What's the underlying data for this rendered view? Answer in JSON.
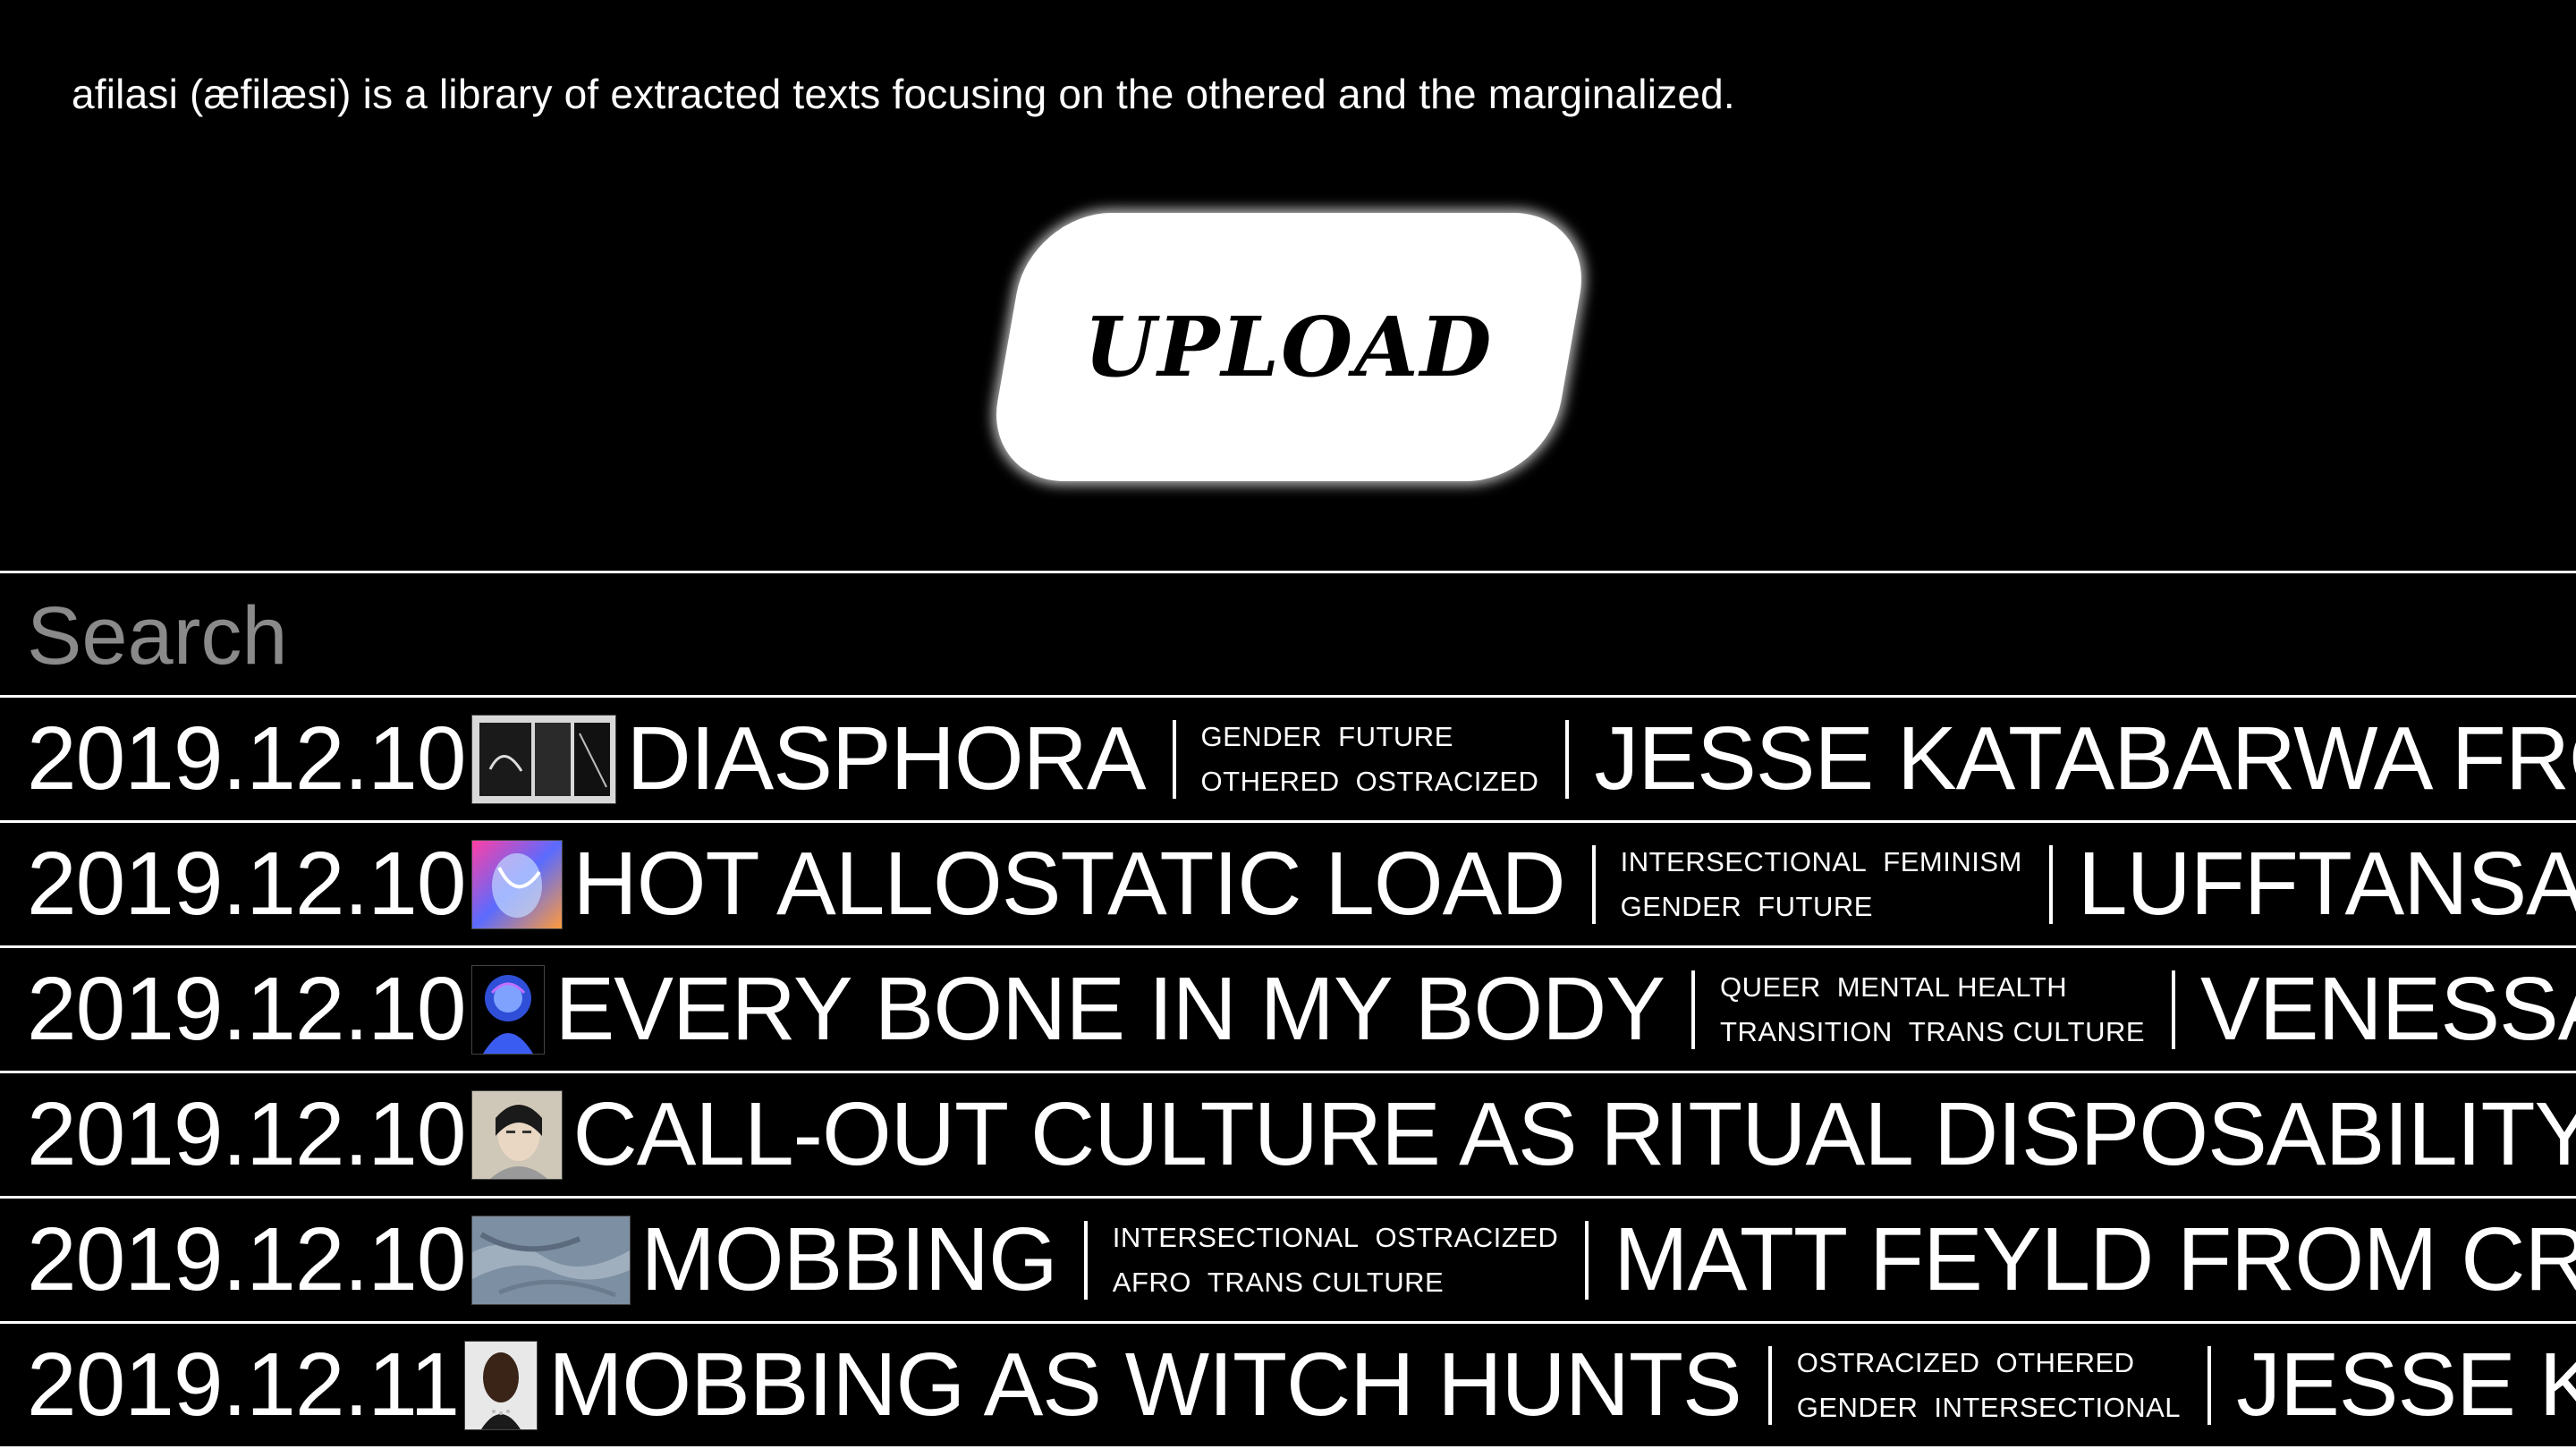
{
  "intro": "afilasi (æfilæsi) is a library of extracted texts focusing on the othered and the marginalized.",
  "upload_label": "UPLOAD",
  "search": {
    "placeholder": "Search",
    "value": ""
  },
  "entries": [
    {
      "date": "2019.12.10",
      "thumb": "thumb-book-photo",
      "title": "DIASPHORA",
      "tags": [
        [
          "GENDER",
          "FUTURE"
        ],
        [
          "OTHERED",
          "OSTRACIZED"
        ]
      ],
      "author": "JESSE KATABARWA FRO"
    },
    {
      "date": "2019.12.10",
      "thumb": "thumb-colorful-figure",
      "title": "HOT ALLOSTATIC LOAD",
      "tags": [
        [
          "INTERSECTIONAL",
          "FEMINISM"
        ],
        [
          "GENDER",
          "FUTURE"
        ]
      ],
      "author": "LUFFTANSA"
    },
    {
      "date": "2019.12.10",
      "thumb": "thumb-blue-figure",
      "title": "EVERY BONE IN MY BODY",
      "tags": [
        [
          "QUEER",
          "MENTAL HEALTH"
        ],
        [
          "TRANSITION",
          "TRANS CULTURE"
        ]
      ],
      "author": "VENESSA"
    },
    {
      "date": "2019.12.10",
      "thumb": "thumb-portrait",
      "title": "CALL-OUT CULTURE AS RITUAL DISPOSABILITY",
      "tags": [],
      "author": ""
    },
    {
      "date": "2019.12.10",
      "thumb": "thumb-texture",
      "title": "MOBBING",
      "tags": [
        [
          "INTERSECTIONAL",
          "OSTRACIZED"
        ],
        [
          "AFRO",
          "TRANS CULTURE"
        ]
      ],
      "author": "MATT FEYLD FROM CRO"
    },
    {
      "date": "2019.12.11",
      "thumb": "thumb-dark-portrait",
      "title": "MOBBING AS WITCH HUNTS",
      "tags": [
        [
          "OSTRACIZED",
          "OTHERED"
        ],
        [
          "GENDER",
          "INTERSECTIONAL"
        ]
      ],
      "author": "JESSE K"
    }
  ]
}
